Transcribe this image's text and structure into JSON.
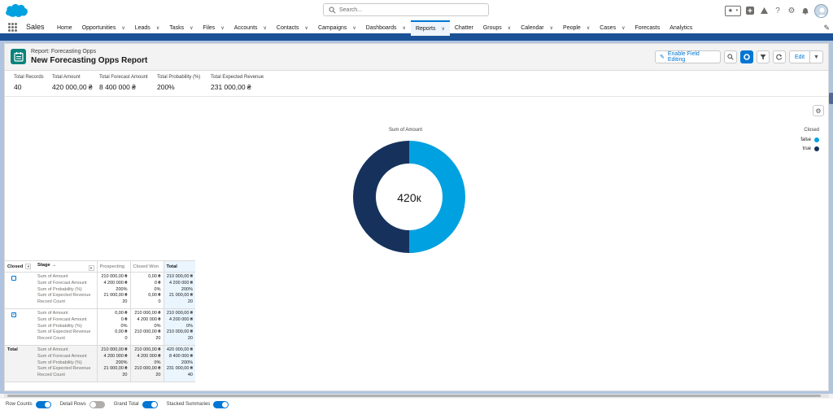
{
  "header": {
    "search_placeholder": "Search..."
  },
  "nav": {
    "app_name": "Sales",
    "items": [
      {
        "label": "Home",
        "chevron": false
      },
      {
        "label": "Opportunities",
        "chevron": true
      },
      {
        "label": "Leads",
        "chevron": true
      },
      {
        "label": "Tasks",
        "chevron": true
      },
      {
        "label": "Files",
        "chevron": true
      },
      {
        "label": "Accounts",
        "chevron": true
      },
      {
        "label": "Contacts",
        "chevron": true
      },
      {
        "label": "Campaigns",
        "chevron": true
      },
      {
        "label": "Dashboards",
        "chevron": true
      },
      {
        "label": "Reports",
        "chevron": true,
        "active": true
      },
      {
        "label": "Chatter",
        "chevron": false
      },
      {
        "label": "Groups",
        "chevron": true
      },
      {
        "label": "Calendar",
        "chevron": true
      },
      {
        "label": "People",
        "chevron": true
      },
      {
        "label": "Cases",
        "chevron": true
      },
      {
        "label": "Forecasts",
        "chevron": false
      },
      {
        "label": "Analytics",
        "chevron": false
      }
    ]
  },
  "report": {
    "type_label": "Report: Forecasting Opps",
    "title": "New Forecasting Opps Report",
    "enable_field_editing": "Enable Field Editing",
    "edit_label": "Edit"
  },
  "summary": [
    {
      "label": "Total Records",
      "value": "40"
    },
    {
      "label": "Total Amount",
      "value": "420 000,00 ₴"
    },
    {
      "label": "Total Forecast Amount",
      "value": "8 400 000 ₴"
    },
    {
      "label": "Total Probability (%)",
      "value": "200%"
    },
    {
      "label": "Total Expected Revenue",
      "value": "231 000,00 ₴"
    }
  ],
  "chart_data": {
    "type": "pie",
    "title": "Sum of Amount",
    "center_label": "420к",
    "legend_title": "Closed",
    "legend_position": "right",
    "slices": [
      {
        "label": "false",
        "value": 210000,
        "color": "#00a1e0"
      },
      {
        "label": "true",
        "value": 210000,
        "color": "#16325c"
      }
    ]
  },
  "table": {
    "headers": {
      "closed": "Closed",
      "stage": "Stage",
      "prospecting": "Prospecting",
      "closed_won": "Closed Won",
      "total": "Total"
    },
    "metrics": [
      "Sum of Amount",
      "Sum of Forecast Amount",
      "Sum of Probability (%)",
      "Sum of Expected Revenue",
      "Record Count"
    ],
    "rows": [
      {
        "closed_checked": false,
        "total_label": "",
        "prospecting": [
          "210 000,00 ₴",
          "4 200 000 ₴",
          "200%",
          "21 000,00 ₴",
          "20"
        ],
        "closed_won": [
          "0,00 ₴",
          "0 ₴",
          "0%",
          "0,00 ₴",
          "0"
        ],
        "total": [
          "210 000,00 ₴",
          "4 200 000 ₴",
          "200%",
          "21 000,00 ₴",
          "20"
        ]
      },
      {
        "closed_checked": true,
        "total_label": "",
        "prospecting": [
          "0,00 ₴",
          "0 ₴",
          "0%",
          "0,00 ₴",
          "0"
        ],
        "closed_won": [
          "210 000,00 ₴",
          "4 200 000 ₴",
          "0%",
          "210 000,00 ₴",
          "20"
        ],
        "total": [
          "210 000,00 ₴",
          "4 200 000 ₴",
          "0%",
          "210 000,00 ₴",
          "20"
        ]
      },
      {
        "closed_checked": null,
        "total_label": "Total",
        "prospecting": [
          "210 000,00 ₴",
          "4 200 000 ₴",
          "200%",
          "21 000,00 ₴",
          "20"
        ],
        "closed_won": [
          "210 000,00 ₴",
          "4 200 000 ₴",
          "0%",
          "210 000,00 ₴",
          "20"
        ],
        "total": [
          "420 000,00 ₴",
          "8 400 000 ₴",
          "200%",
          "231 000,00 ₴",
          "40"
        ]
      }
    ]
  },
  "footer": {
    "toggles": [
      {
        "label": "Row Counts",
        "on": true
      },
      {
        "label": "Detail Rows",
        "on": false
      },
      {
        "label": "Grand Total",
        "on": true
      },
      {
        "label": "Stacked Summaries",
        "on": true
      }
    ]
  }
}
